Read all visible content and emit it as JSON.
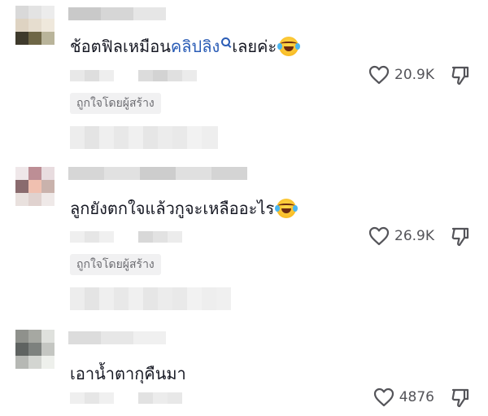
{
  "comments": [
    {
      "text_before_link": "ช้อตฟิลเหมือน",
      "link_text": "คลิปลิง",
      "text_after_link": "เลยค่ะ",
      "emoji": "laughing-tears-emoji",
      "likes": "20.9K",
      "liked_by_creator": "ถูกใจโดยผู้สร้าง"
    },
    {
      "text": "ลูกยังตกใจแล้วกูจะเหลืออะไร",
      "emoji": "laughing-tears-emoji",
      "likes": "26.9K",
      "liked_by_creator": "ถูกใจโดยผู้สร้าง"
    },
    {
      "text": "เอาน้ำตากุคืนมา",
      "likes": "4876"
    }
  ],
  "icons": {
    "like": "heart-outline-icon",
    "dislike": "thumbs-down-icon",
    "search": "search-icon"
  },
  "colors": {
    "link": "#2b5db6",
    "text": "#161823",
    "secondary": "#545459",
    "chip_bg": "#f1f1f2"
  }
}
